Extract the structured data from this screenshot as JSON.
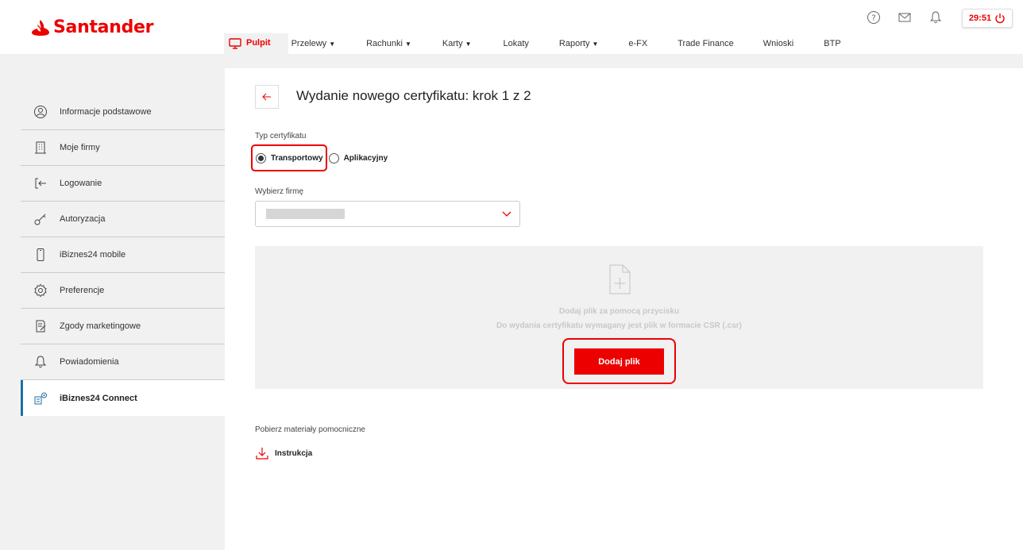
{
  "brand": {
    "name": "Santander",
    "accent": "#ec0000"
  },
  "nav": {
    "items": [
      {
        "label": "Pulpit",
        "icon": "monitor-icon",
        "active": true
      },
      {
        "label": "Przelewy",
        "caret": true
      },
      {
        "label": "Rachunki",
        "caret": true
      },
      {
        "label": "Karty",
        "caret": true
      },
      {
        "label": "Lokaty"
      },
      {
        "label": "Raporty",
        "caret": true
      },
      {
        "label": "e-FX"
      },
      {
        "label": "Trade Finance"
      },
      {
        "label": "Wnioski"
      },
      {
        "label": "BTP"
      }
    ]
  },
  "header": {
    "icons": [
      "help-icon",
      "mail-icon",
      "bell-icon"
    ],
    "timer": "29:51"
  },
  "sidebar": {
    "items": [
      {
        "label": "Informacje podstawowe",
        "icon": "user-icon"
      },
      {
        "label": "Moje firmy",
        "icon": "building-icon"
      },
      {
        "label": "Logowanie",
        "icon": "login-icon"
      },
      {
        "label": "Autoryzacja",
        "icon": "key-icon"
      },
      {
        "label": "iBiznes24 mobile",
        "icon": "phone-icon"
      },
      {
        "label": "Preferencje",
        "icon": "gear-icon"
      },
      {
        "label": "Zgody marketingowe",
        "icon": "document-icon"
      },
      {
        "label": "Powiadomienia",
        "icon": "bell-icon"
      },
      {
        "label": "iBiznes24 Connect",
        "icon": "connect-icon",
        "active": true
      }
    ]
  },
  "main": {
    "title": "Wydanie nowego certyfikatu: krok 1 z 2",
    "cert_type_label": "Typ certyfikatu",
    "cert_types": [
      {
        "label": "Transportowy",
        "selected": true
      },
      {
        "label": "Aplikacyjny",
        "selected": false
      }
    ],
    "firm_label": "Wybierz firmę",
    "dropzone": {
      "line1": "Dodaj plik za pomocą przycisku",
      "line2": "Do wydania certyfikatu wymagany jest plik w formacie CSR (.csr)",
      "button": "Dodaj plik"
    },
    "materials_label": "Pobierz materiały pomocniczne",
    "instruction_link": "Instrukcja"
  }
}
